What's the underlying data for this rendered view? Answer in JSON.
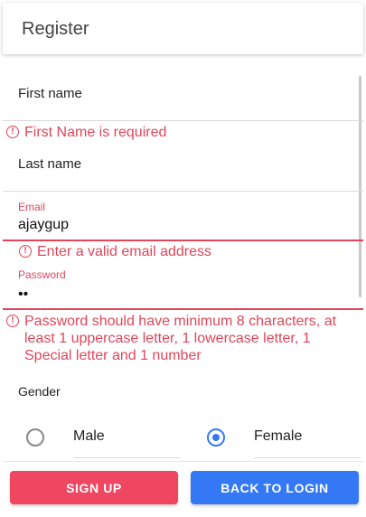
{
  "header": {
    "title": "Register"
  },
  "form": {
    "first_name": {
      "label": "First name",
      "error": "First Name is required"
    },
    "last_name": {
      "label": "Last name"
    },
    "email": {
      "label": "Email",
      "value": "ajaygup",
      "error": "Enter a valid email address"
    },
    "password": {
      "label": "Password",
      "value": "••",
      "error": "Password should have minimum 8 characters, at least 1 uppercase letter, 1 lowercase letter, 1 Special letter and 1 number"
    },
    "gender": {
      "label": "Gender",
      "options": [
        {
          "label": "Male",
          "selected": false
        },
        {
          "label": "Female",
          "selected": true
        }
      ]
    }
  },
  "buttons": {
    "signup_label": "SIGN UP",
    "login_label": "BACK TO LOGIN"
  },
  "colors": {
    "error": "#e0455a",
    "primary": "#3478f6",
    "signup": "#ef4661"
  },
  "icons": {
    "error": "error-circle-icon"
  }
}
